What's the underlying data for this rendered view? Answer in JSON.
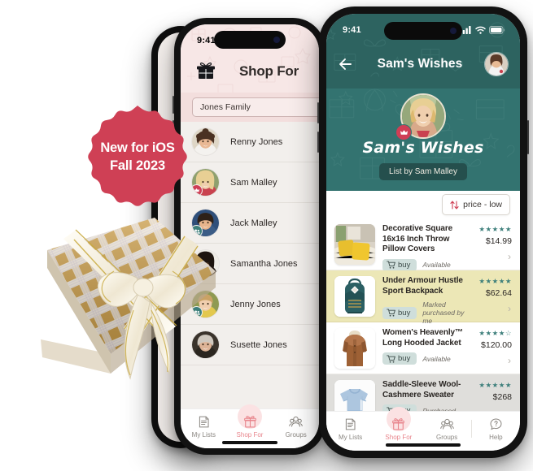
{
  "badge": {
    "line1": "New for iOS",
    "line2": "Fall 2023",
    "color": "#cf4055"
  },
  "middle_phone": {
    "statusbar": {
      "clock": "9:41"
    },
    "header": {
      "title": "Shop For",
      "logo_icon": "gift-box-logo-icon"
    },
    "search": {
      "value": "Jones Family"
    },
    "people": [
      {
        "name": "Renny Jones",
        "badge": "none"
      },
      {
        "name": "Sam Malley",
        "badge": "crown"
      },
      {
        "name": "Jack Malley",
        "badge": "teal"
      },
      {
        "name": "Samantha Jones",
        "badge": "none"
      },
      {
        "name": "Jenny Jones",
        "badge": "teal"
      },
      {
        "name": "Susette Jones",
        "badge": "none"
      }
    ],
    "tabs": [
      {
        "label": "My Lists",
        "icon": "lists-icon",
        "active": false
      },
      {
        "label": "Shop For",
        "icon": "gift-icon",
        "active": true
      },
      {
        "label": "Groups",
        "icon": "groups-icon",
        "active": false
      }
    ]
  },
  "front_phone": {
    "statusbar": {
      "clock": "9:41",
      "cellular_icon": "signal-bars-icon",
      "wifi_icon": "wifi-icon",
      "battery_icon": "battery-icon"
    },
    "nav": {
      "back_icon": "back-arrow-icon",
      "title": "Sam's Wishes",
      "avatar": "user-avatar"
    },
    "hero": {
      "title": "Sam's Wishes",
      "subtitle": "List by Sam Malley",
      "crown_icon": "crown-icon"
    },
    "sort": {
      "label": "price - low",
      "icon": "sort-arrows-icon"
    },
    "products": [
      {
        "title": "Decorative Square 16x16 Inch Throw Pillow Covers",
        "stars": "★★★★★",
        "price": "$14.99",
        "buy_label": "buy",
        "status": "Available",
        "state": "normal",
        "image": "yellow-throw-pillows"
      },
      {
        "title": "Under Armour Hustle Sport Backpack",
        "stars": "★★★★★",
        "price": "$62.64",
        "buy_label": "buy",
        "status": "Marked purchased by me",
        "state": "highlight",
        "image": "teal-backpack"
      },
      {
        "title": "Women's Heavenly™ Long Hooded Jacket",
        "stars": "★★★★☆",
        "price": "$120.00",
        "buy_label": "buy",
        "status": "Available",
        "state": "normal",
        "image": "brown-hooded-jacket"
      },
      {
        "title": "Saddle-Sleeve Wool-Cashmere Sweater",
        "stars": "★★★★★",
        "price": "$268",
        "buy_label": "buy",
        "status": "Purchased",
        "state": "dim",
        "image": "blue-sweater"
      }
    ],
    "tabs": [
      {
        "label": "My Lists",
        "icon": "lists-icon",
        "active": false
      },
      {
        "label": "Shop For",
        "icon": "gift-icon",
        "active": true
      },
      {
        "label": "Groups",
        "icon": "groups-icon",
        "active": false
      },
      {
        "label": "Help",
        "icon": "help-icon",
        "active": false
      }
    ]
  }
}
